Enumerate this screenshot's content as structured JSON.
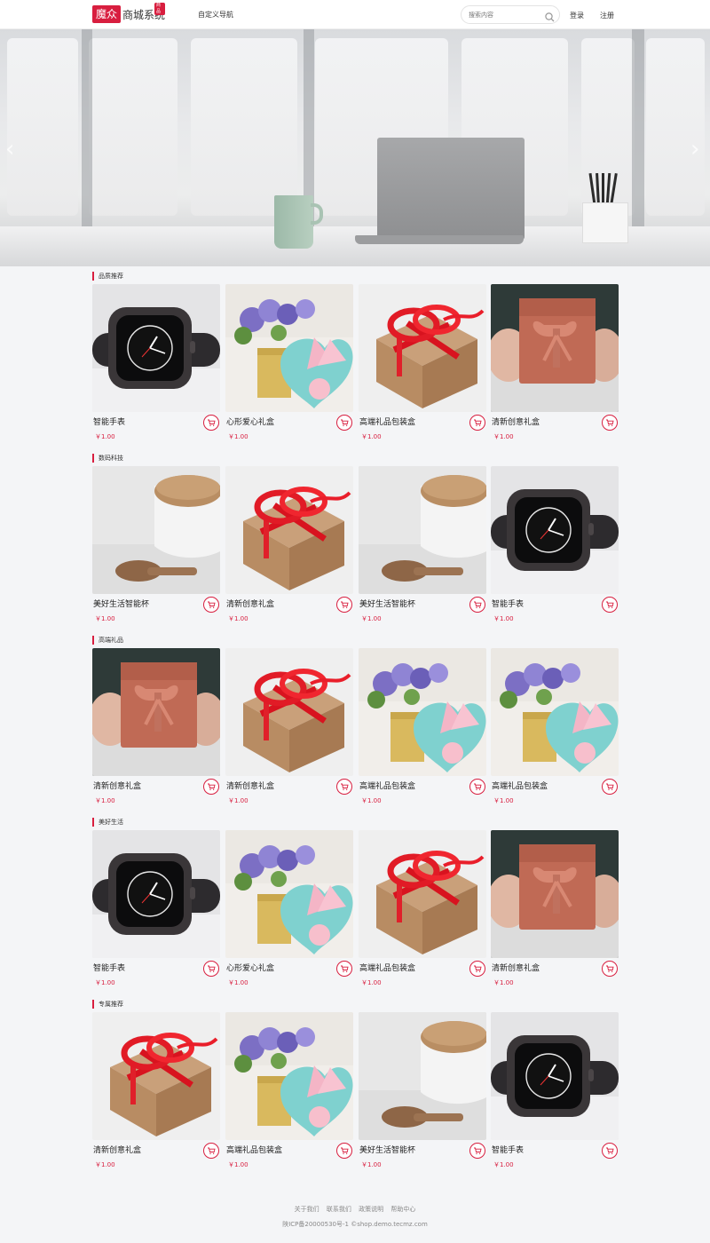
{
  "header": {
    "logo_mark": "魔众",
    "logo_text": "商城系统",
    "logo_badge": "商品",
    "nav_link": "自定义导航",
    "search_placeholder": "搜索内容",
    "login": "登录",
    "register": "注册"
  },
  "sections": [
    {
      "title": "品质推荐",
      "products": [
        {
          "name": "智能手表",
          "price": "￥1.00",
          "image": "watch"
        },
        {
          "name": "心形爱心礼盒",
          "price": "￥1.00",
          "image": "heartbox"
        },
        {
          "name": "高端礼品包装盒",
          "price": "￥1.00",
          "image": "ribbonbox"
        },
        {
          "name": "清新创意礼盒",
          "price": "￥1.00",
          "image": "handbox"
        }
      ]
    },
    {
      "title": "数码科技",
      "products": [
        {
          "name": "美好生活智能杯",
          "price": "￥1.00",
          "image": "cup"
        },
        {
          "name": "清新创意礼盒",
          "price": "￥1.00",
          "image": "ribbonbox"
        },
        {
          "name": "美好生活智能杯",
          "price": "￥1.00",
          "image": "cup"
        },
        {
          "name": "智能手表",
          "price": "￥1.00",
          "image": "watch"
        }
      ]
    },
    {
      "title": "高端礼品",
      "products": [
        {
          "name": "清新创意礼盒",
          "price": "￥1.00",
          "image": "handbox"
        },
        {
          "name": "清新创意礼盒",
          "price": "￥1.00",
          "image": "ribbonbox"
        },
        {
          "name": "高端礼品包装盒",
          "price": "￥1.00",
          "image": "heartbox"
        },
        {
          "name": "高端礼品包装盒",
          "price": "￥1.00",
          "image": "heartbox"
        }
      ]
    },
    {
      "title": "美好生活",
      "products": [
        {
          "name": "智能手表",
          "price": "￥1.00",
          "image": "watch"
        },
        {
          "name": "心形爱心礼盒",
          "price": "￥1.00",
          "image": "heartbox"
        },
        {
          "name": "高端礼品包装盒",
          "price": "￥1.00",
          "image": "ribbonbox"
        },
        {
          "name": "清新创意礼盒",
          "price": "￥1.00",
          "image": "handbox"
        }
      ]
    },
    {
      "title": "专属推荐",
      "products": [
        {
          "name": "清新创意礼盒",
          "price": "￥1.00",
          "image": "ribbonbox"
        },
        {
          "name": "高端礼品包装盒",
          "price": "￥1.00",
          "image": "heartbox"
        },
        {
          "name": "美好生活智能杯",
          "price": "￥1.00",
          "image": "cup"
        },
        {
          "name": "智能手表",
          "price": "￥1.00",
          "image": "watch"
        }
      ]
    }
  ],
  "footer": {
    "links": [
      "关于我们",
      "联系我们",
      "政策说明",
      "帮助中心"
    ],
    "icp": "陕ICP备20000530号-1 ©shop.demo.tecmz.com"
  },
  "colors": {
    "accent": "#d81e3f",
    "page_bg": "#f4f5f7"
  }
}
